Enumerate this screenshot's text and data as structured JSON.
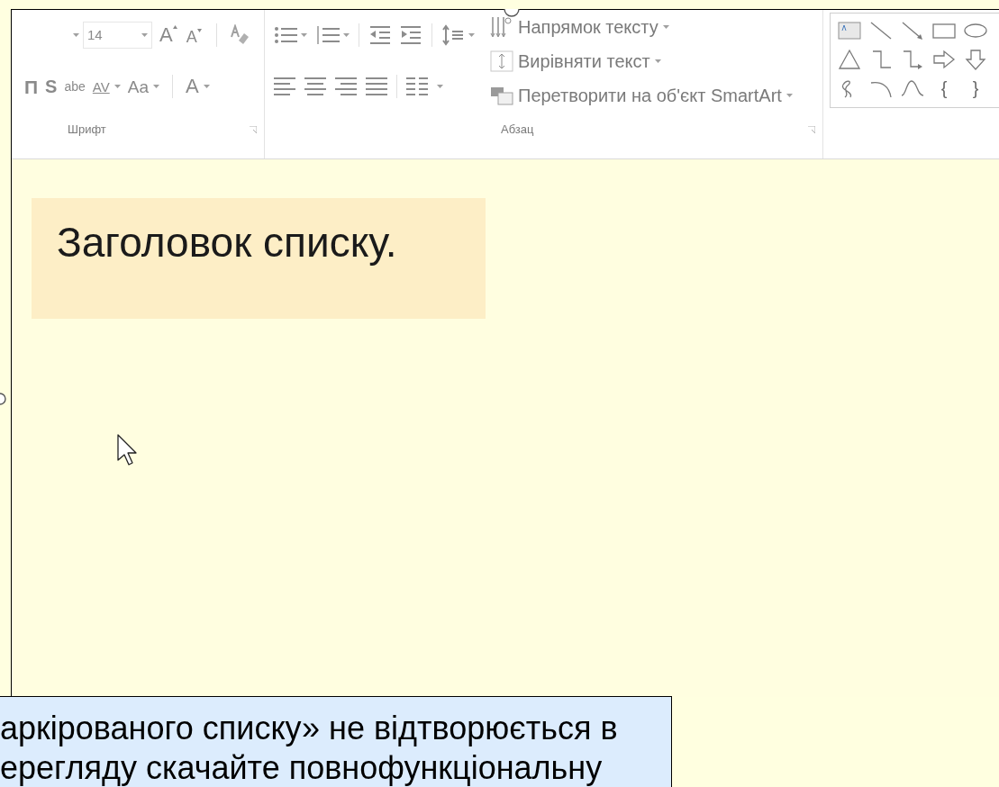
{
  "ribbon": {
    "font_size": "14",
    "font_row1": [
      "A",
      "A"
    ],
    "font_row2": [
      "П",
      "S",
      "abe",
      "AV",
      "Aa",
      "A"
    ],
    "font_group_label": "Шрифт",
    "paragraph_commands": [
      {
        "label": "Напрямок тексту"
      },
      {
        "label": "Вирівняти текст"
      },
      {
        "label": "Перетворити на об'єкт SmartArt"
      }
    ],
    "paragraph_group_label": "Абзац",
    "shape_braces": [
      "{",
      "}"
    ]
  },
  "slide": {
    "title": "Заголовок списку."
  },
  "notice": {
    "lines": [
      "аркірованого списку» не відтворюється в",
      "ерегляду скачайте повнофункціональну"
    ]
  }
}
